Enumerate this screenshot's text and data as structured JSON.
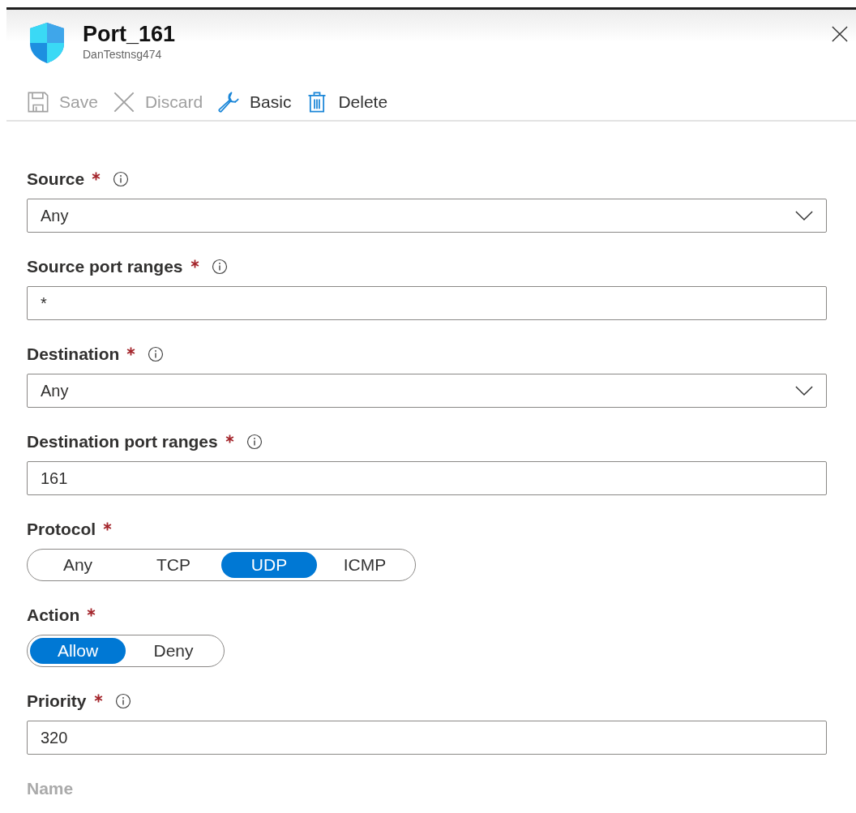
{
  "header": {
    "title": "Port_161",
    "subtitle": "DanTestnsg474"
  },
  "toolbar": [
    {
      "kind": "save",
      "label": "Save",
      "disabled": true
    },
    {
      "kind": "discard",
      "label": "Discard",
      "disabled": true
    },
    {
      "kind": "basic",
      "label": "Basic",
      "disabled": false
    },
    {
      "kind": "delete",
      "label": "Delete",
      "disabled": false
    }
  ],
  "fields": [
    {
      "kind": "dropdown",
      "label": "Source",
      "required": true,
      "info": true,
      "value": "Any"
    },
    {
      "kind": "text",
      "label": "Source port ranges",
      "required": true,
      "info": true,
      "value": "*"
    },
    {
      "kind": "dropdown",
      "label": "Destination",
      "required": true,
      "info": true,
      "value": "Any"
    },
    {
      "kind": "text",
      "label": "Destination port ranges",
      "required": true,
      "info": true,
      "value": "161"
    },
    {
      "kind": "toggle",
      "label": "Protocol",
      "required": true,
      "info": false,
      "options": [
        {
          "label": "Any",
          "selected": false
        },
        {
          "label": "TCP",
          "selected": false
        },
        {
          "label": "UDP",
          "selected": true
        },
        {
          "label": "ICMP",
          "selected": false
        }
      ]
    },
    {
      "kind": "toggle",
      "label": "Action",
      "required": true,
      "info": false,
      "options": [
        {
          "label": "Allow",
          "selected": true
        },
        {
          "label": "Deny",
          "selected": false
        }
      ]
    },
    {
      "kind": "text",
      "label": "Priority",
      "required": true,
      "info": true,
      "value": "320"
    },
    {
      "kind": "cut",
      "label": "Name"
    }
  ]
}
